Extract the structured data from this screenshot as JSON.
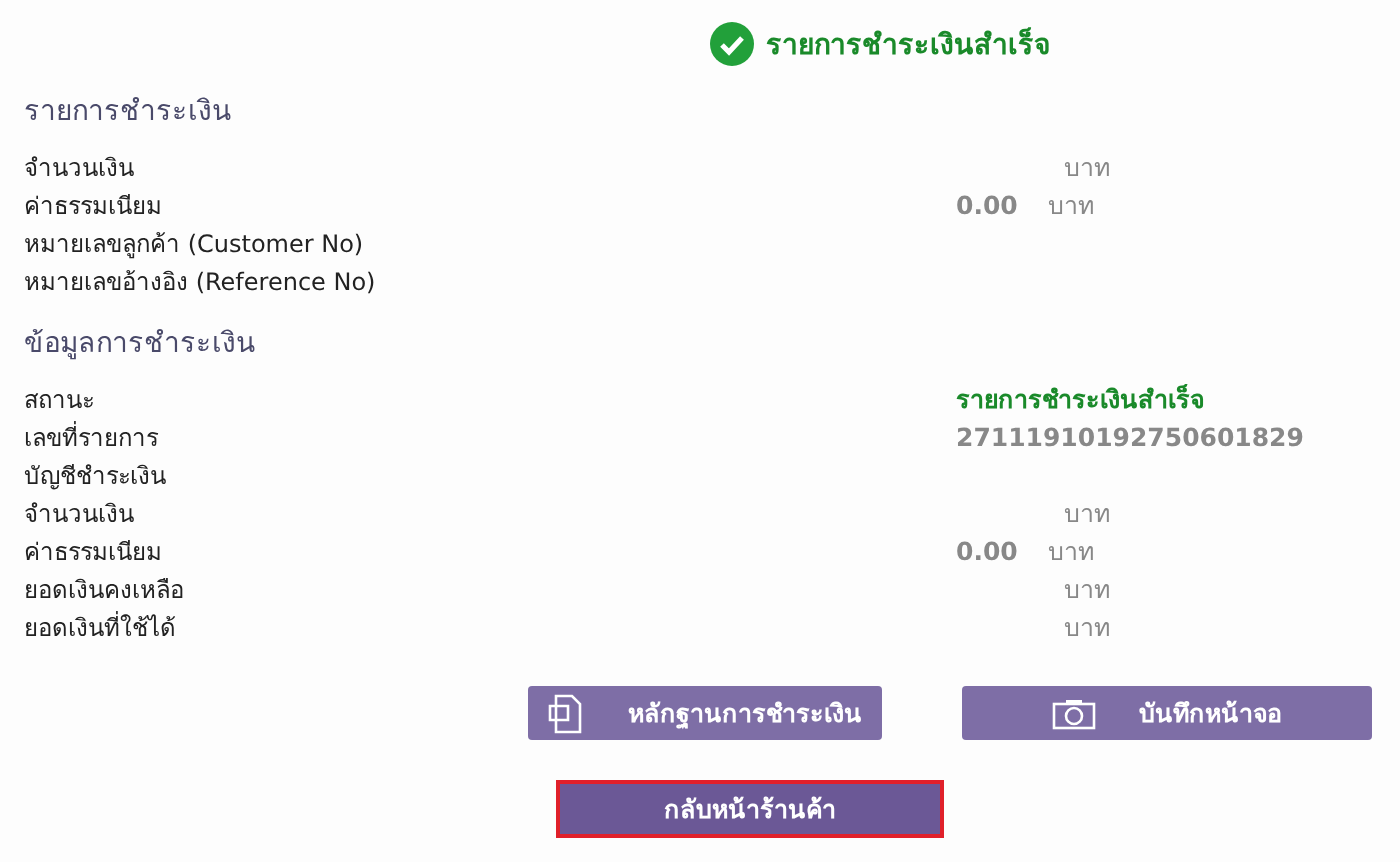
{
  "header": {
    "title": "รายการชำระเงินสำเร็จ"
  },
  "sections": [
    {
      "title": "รายการชำระเงิน",
      "rows": [
        {
          "label": "จำนวนเงิน",
          "kind": "amount",
          "unit": "บาท"
        },
        {
          "label": "ค่าธรรมเนียม",
          "kind": "amount",
          "amount": "0.00",
          "unit": "บาท"
        },
        {
          "label": "หมายเลขลูกค้า (Customer No)",
          "kind": "text"
        },
        {
          "label": "หมายเลขอ้างอิง (Reference No)",
          "kind": "text"
        }
      ]
    },
    {
      "title": "ข้อมูลการชำระเงิน",
      "rows": [
        {
          "label": "สถานะ",
          "kind": "status",
          "value": "รายการชำระเงินสำเร็จ"
        },
        {
          "label": "เลขที่รายการ",
          "kind": "text",
          "value": "27111910192750601829"
        },
        {
          "label": "บัญชีชำระเงิน",
          "kind": "text"
        },
        {
          "label": "จำนวนเงิน",
          "kind": "amount",
          "unit": "บาท"
        },
        {
          "label": "ค่าธรรมเนียม",
          "kind": "amount",
          "amount": "0.00",
          "unit": "บาท"
        },
        {
          "label": "ยอดเงินคงเหลือ",
          "kind": "amount",
          "unit": "บาท"
        },
        {
          "label": "ยอดเงินที่ใช้ได้",
          "kind": "amount",
          "unit": "บาท"
        }
      ]
    }
  ],
  "actions": [
    {
      "label": "หลักฐานการชำระเงิน",
      "kind": "document"
    },
    {
      "label": "บันทึกหน้าจอ",
      "kind": "camera"
    }
  ],
  "back_button": {
    "label": "กลับหน้าร้านค้า",
    "selected": true
  }
}
